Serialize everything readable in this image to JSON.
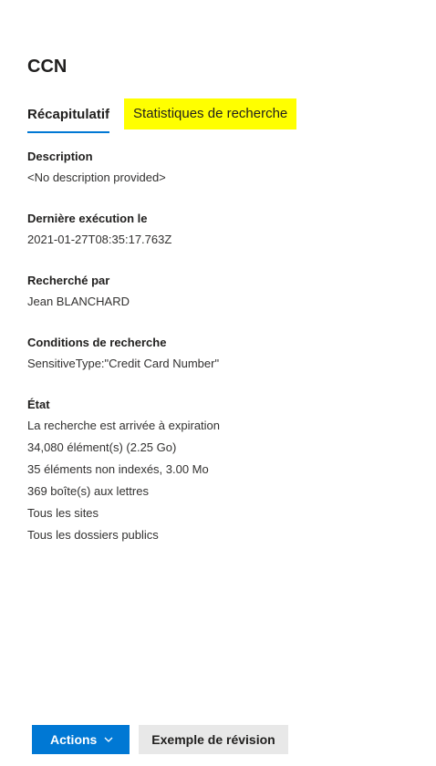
{
  "panel": {
    "title": "CCN"
  },
  "tabs": [
    {
      "label": "Récapitulatif"
    },
    {
      "label": "Statistiques de recherche"
    }
  ],
  "details": {
    "description": {
      "label": "Description",
      "value": "<No description provided>"
    },
    "last_run": {
      "label": "Dernière exécution le",
      "value": "2021-01-27T08:35:17.763Z"
    },
    "searched_by": {
      "label": "Recherché par",
      "value": "Jean BLANCHARD"
    },
    "conditions": {
      "label": "Conditions de recherche",
      "value": "SensitiveType:\"Credit Card Number\""
    },
    "state": {
      "label": "État",
      "lines": [
        "La recherche est arrivée à expiration",
        "34,080 élément(s) (2.25 Go)",
        "35 éléments non indexés, 3.00 Mo",
        "369 boîte(s) aux lettres",
        "Tous les sites",
        "Tous les dossiers publics"
      ]
    }
  },
  "footer": {
    "actions_label": "Actions",
    "review_label": "Exemple de révision"
  },
  "colors": {
    "accent": "#0078d4",
    "highlight": "#ffff00",
    "secondary_button": "#e8e8e8"
  }
}
